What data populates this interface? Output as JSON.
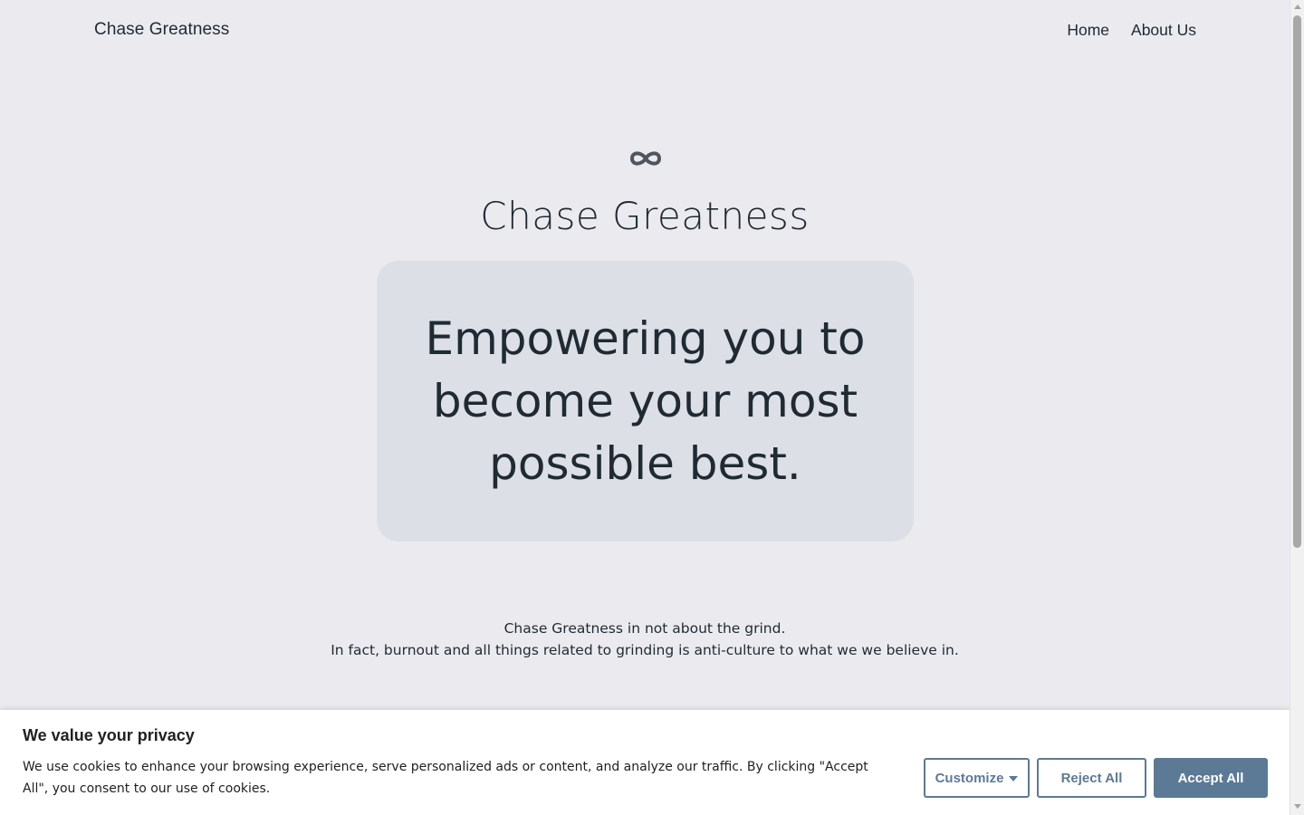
{
  "header": {
    "brand": "Chase Greatness",
    "nav": [
      {
        "label": "Home"
      },
      {
        "label": "About Us"
      }
    ]
  },
  "hero": {
    "icon": "infinity-icon",
    "title": "Chase Greatness",
    "tagline": "Empowering you to become your most possible best.",
    "intro_line1": "Chase Greatness in not about the grind.",
    "intro_line2": "In fact, burnout and all things related to grinding is anti-culture to what we we believe in."
  },
  "cookie_banner": {
    "title": "We value your privacy",
    "text": "We use cookies to enhance your browsing experience, serve personalized ads or content, and analyze our traffic. By clicking \"Accept All\", you consent to our use of cookies.",
    "customize_label": "Customize",
    "reject_label": "Reject All",
    "accept_label": "Accept All"
  },
  "colors": {
    "background": "#ebebef",
    "card": "#dcdfe6",
    "accent": "#5c7a96",
    "text": "#1f2a33"
  }
}
